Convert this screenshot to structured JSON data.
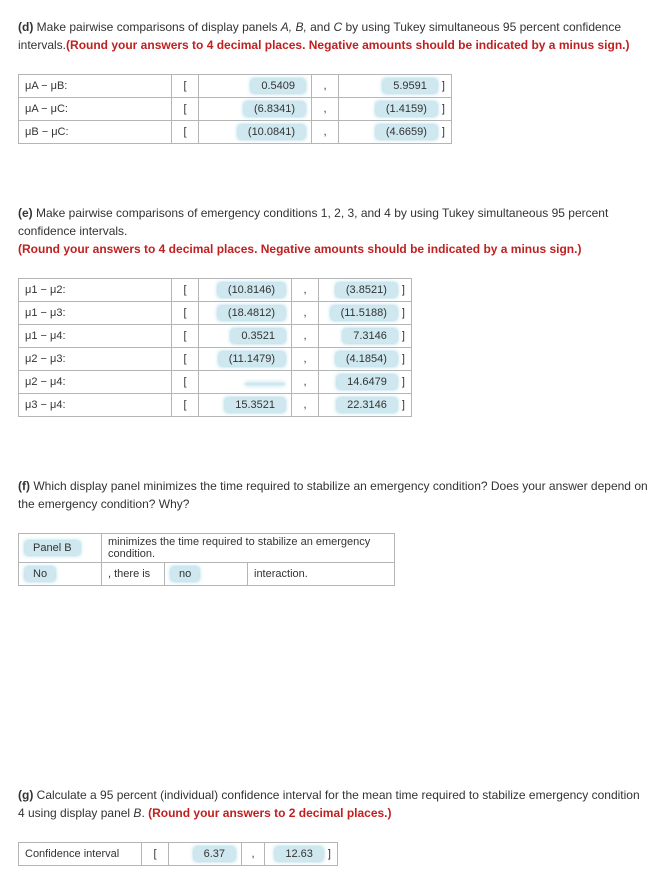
{
  "d": {
    "prompt_bold": "(d)",
    "prompt_text1": " Make pairwise comparisons of display panels ",
    "prompt_ital": "A, B,",
    "prompt_text2": " and ",
    "prompt_ital2": "C",
    "prompt_text3": " by using Tukey simultaneous 95 percent confidence intervals.",
    "prompt_red": "(Round your answers to 4 decimal places. Negative amounts should be indicated by a minus sign.)",
    "rows": [
      {
        "label": "μA − μB:",
        "lo": "0.5409",
        "hi": "5.9591"
      },
      {
        "label": "μA − μC:",
        "lo": "(6.8341)",
        "hi": "(1.4159)"
      },
      {
        "label": "μB − μC:",
        "lo": "(10.0841)",
        "hi": "(4.6659)"
      }
    ]
  },
  "e": {
    "prompt_bold": "(e)",
    "prompt_text1": " Make pairwise comparisons of emergency conditions 1, 2, 3, and 4 by using Tukey simultaneous 95 percent confidence intervals. ",
    "prompt_red": "(Round your answers to 4 decimal places. Negative amounts should be indicated by a minus sign.)",
    "rows": [
      {
        "label": "μ1 − μ2:",
        "lo": "(10.8146)",
        "hi": "(3.8521)"
      },
      {
        "label": "μ1 − μ3:",
        "lo": "(18.4812)",
        "hi": "(11.5188)"
      },
      {
        "label": "μ1 − μ4:",
        "lo": "0.3521",
        "hi": "7.3146"
      },
      {
        "label": "μ2 − μ3:",
        "lo": "(11.1479)",
        "hi": "(4.1854)"
      },
      {
        "label": "μ2 − μ4:",
        "lo": "",
        "hi": "14.6479"
      },
      {
        "label": "μ3 − μ4:",
        "lo": "15.3521",
        "hi": "22.3146"
      }
    ]
  },
  "f": {
    "prompt_bold": "(f)",
    "prompt_text": "  Which display panel minimizes the time required to stabilize an emergency condition? Does your answer depend on the emergency condition? Why?",
    "row1_sel": "Panel B",
    "row1_text": "minimizes the time required to stabilize an emergency condition.",
    "row2_sel1": "No",
    "row2_text1": ", there is",
    "row2_sel2": "no",
    "row2_text2": "interaction."
  },
  "g": {
    "prompt_bold": "(g)",
    "prompt_text1": " Calculate a 95 percent (individual) confidence interval for the mean time required to stabilize emergency condition 4 using display panel ",
    "prompt_ital": "B",
    "prompt_text2": ". ",
    "prompt_red": "(Round your answers to 2 decimal places.)",
    "label": "Confidence interval",
    "lo": "6.37",
    "hi": "12.63"
  }
}
